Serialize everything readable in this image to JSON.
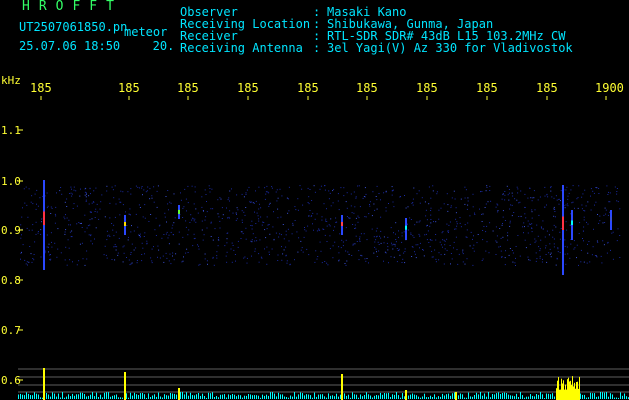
{
  "header": {
    "brand": "HROFFT",
    "filename": "UT2507061850.pn",
    "mode": "meteor",
    "datetime": "25.07.06 18:50",
    "count": "20."
  },
  "info": [
    {
      "label": "Observer",
      "value": "Masaki Kano"
    },
    {
      "label": "Receiving Location",
      "value": "Shibukawa, Gunma, Japan"
    },
    {
      "label": "Receiver",
      "value": "RTL-SDR SDR# 43dB L15 103.2MHz CW"
    },
    {
      "label": "Receiving Antenna",
      "value": "3el Yagi(V) Az 330 for Vladivostok"
    }
  ],
  "info_separator": ":",
  "axis": {
    "y_unit": "kHz",
    "x_ticks": [
      "185",
      "185",
      "185",
      "185",
      "185",
      "185",
      "185",
      "185",
      "185",
      "1900"
    ],
    "y_ticks": [
      "1.1",
      "1.0",
      "0.9",
      "0.8",
      "0.7",
      "0.6"
    ]
  },
  "colors": {
    "text_cyan": "#00e5ff",
    "text_yellow": "#ffff33",
    "brand_green": "#33ff66",
    "signal_yellow": "#ffff00",
    "signal_cyan": "#00ffff",
    "noise_blue": "#1a2aa0"
  }
}
